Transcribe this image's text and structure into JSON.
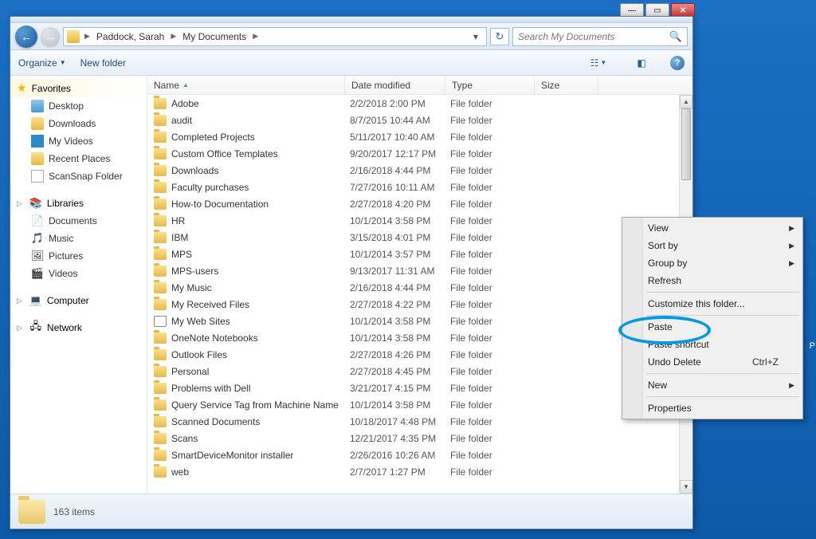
{
  "window": {
    "breadcrumb": [
      "Paddock, Sarah",
      "My Documents"
    ],
    "search_placeholder": "Search My Documents"
  },
  "cmdbar": {
    "organize": "Organize",
    "newfolder": "New folder"
  },
  "nav": {
    "favorites_label": "Favorites",
    "favorites": [
      "Desktop",
      "Downloads",
      "My Videos",
      "Recent Places",
      "ScanSnap Folder"
    ],
    "libraries_label": "Libraries",
    "libraries": [
      "Documents",
      "Music",
      "Pictures",
      "Videos"
    ],
    "computer_label": "Computer",
    "network_label": "Network"
  },
  "columns": {
    "name": "Name",
    "date": "Date modified",
    "type": "Type",
    "size": "Size",
    "w_name": 248,
    "w_date": 126,
    "w_type": 112,
    "w_size": 80
  },
  "files": [
    {
      "name": "Adobe",
      "date": "2/2/2018 2:00 PM",
      "type": "File folder"
    },
    {
      "name": "audit",
      "date": "8/7/2015 10:44 AM",
      "type": "File folder"
    },
    {
      "name": "Completed Projects",
      "date": "5/11/2017 10:40 AM",
      "type": "File folder"
    },
    {
      "name": "Custom Office Templates",
      "date": "9/20/2017 12:17 PM",
      "type": "File folder"
    },
    {
      "name": "Downloads",
      "date": "2/16/2018 4:44 PM",
      "type": "File folder"
    },
    {
      "name": "Faculty purchases",
      "date": "7/27/2016 10:11 AM",
      "type": "File folder"
    },
    {
      "name": "How-to Documentation",
      "date": "2/27/2018 4:20 PM",
      "type": "File folder"
    },
    {
      "name": "HR",
      "date": "10/1/2014 3:58 PM",
      "type": "File folder"
    },
    {
      "name": "IBM",
      "date": "3/15/2018 4:01 PM",
      "type": "File folder"
    },
    {
      "name": "MPS",
      "date": "10/1/2014 3:57 PM",
      "type": "File folder"
    },
    {
      "name": "MPS-users",
      "date": "9/13/2017 11:31 AM",
      "type": "File folder"
    },
    {
      "name": "My Music",
      "date": "2/16/2018 4:44 PM",
      "type": "File folder"
    },
    {
      "name": "My Received Files",
      "date": "2/27/2018 4:22 PM",
      "type": "File folder"
    },
    {
      "name": "My Web Sites",
      "date": "10/1/2014 3:58 PM",
      "type": "File folder",
      "icon": "web"
    },
    {
      "name": "OneNote Notebooks",
      "date": "10/1/2014 3:58 PM",
      "type": "File folder"
    },
    {
      "name": "Outlook Files",
      "date": "2/27/2018 4:26 PM",
      "type": "File folder"
    },
    {
      "name": "Personal",
      "date": "2/27/2018 4:45 PM",
      "type": "File folder"
    },
    {
      "name": "Problems with Dell",
      "date": "3/21/2017 4:15 PM",
      "type": "File folder"
    },
    {
      "name": "Query Service Tag from Machine Name",
      "date": "10/1/2014 3:58 PM",
      "type": "File folder"
    },
    {
      "name": "Scanned Documents",
      "date": "10/18/2017 4:48 PM",
      "type": "File folder"
    },
    {
      "name": "Scans",
      "date": "12/21/2017 4:35 PM",
      "type": "File folder"
    },
    {
      "name": "SmartDeviceMonitor installer",
      "date": "2/26/2016 10:26 AM",
      "type": "File folder"
    },
    {
      "name": "web",
      "date": "2/7/2017 1:27 PM",
      "type": "File folder"
    }
  ],
  "status": {
    "count": "163 items"
  },
  "context_menu": {
    "view": "View",
    "sortby": "Sort by",
    "groupby": "Group by",
    "refresh": "Refresh",
    "customize": "Customize this folder...",
    "paste": "Paste",
    "pasteshortcut": "Paste shortcut",
    "undodelete": "Undo Delete",
    "undoshortcut": "Ctrl+Z",
    "new": "New",
    "properties": "Properties"
  },
  "annotation_label": "P"
}
